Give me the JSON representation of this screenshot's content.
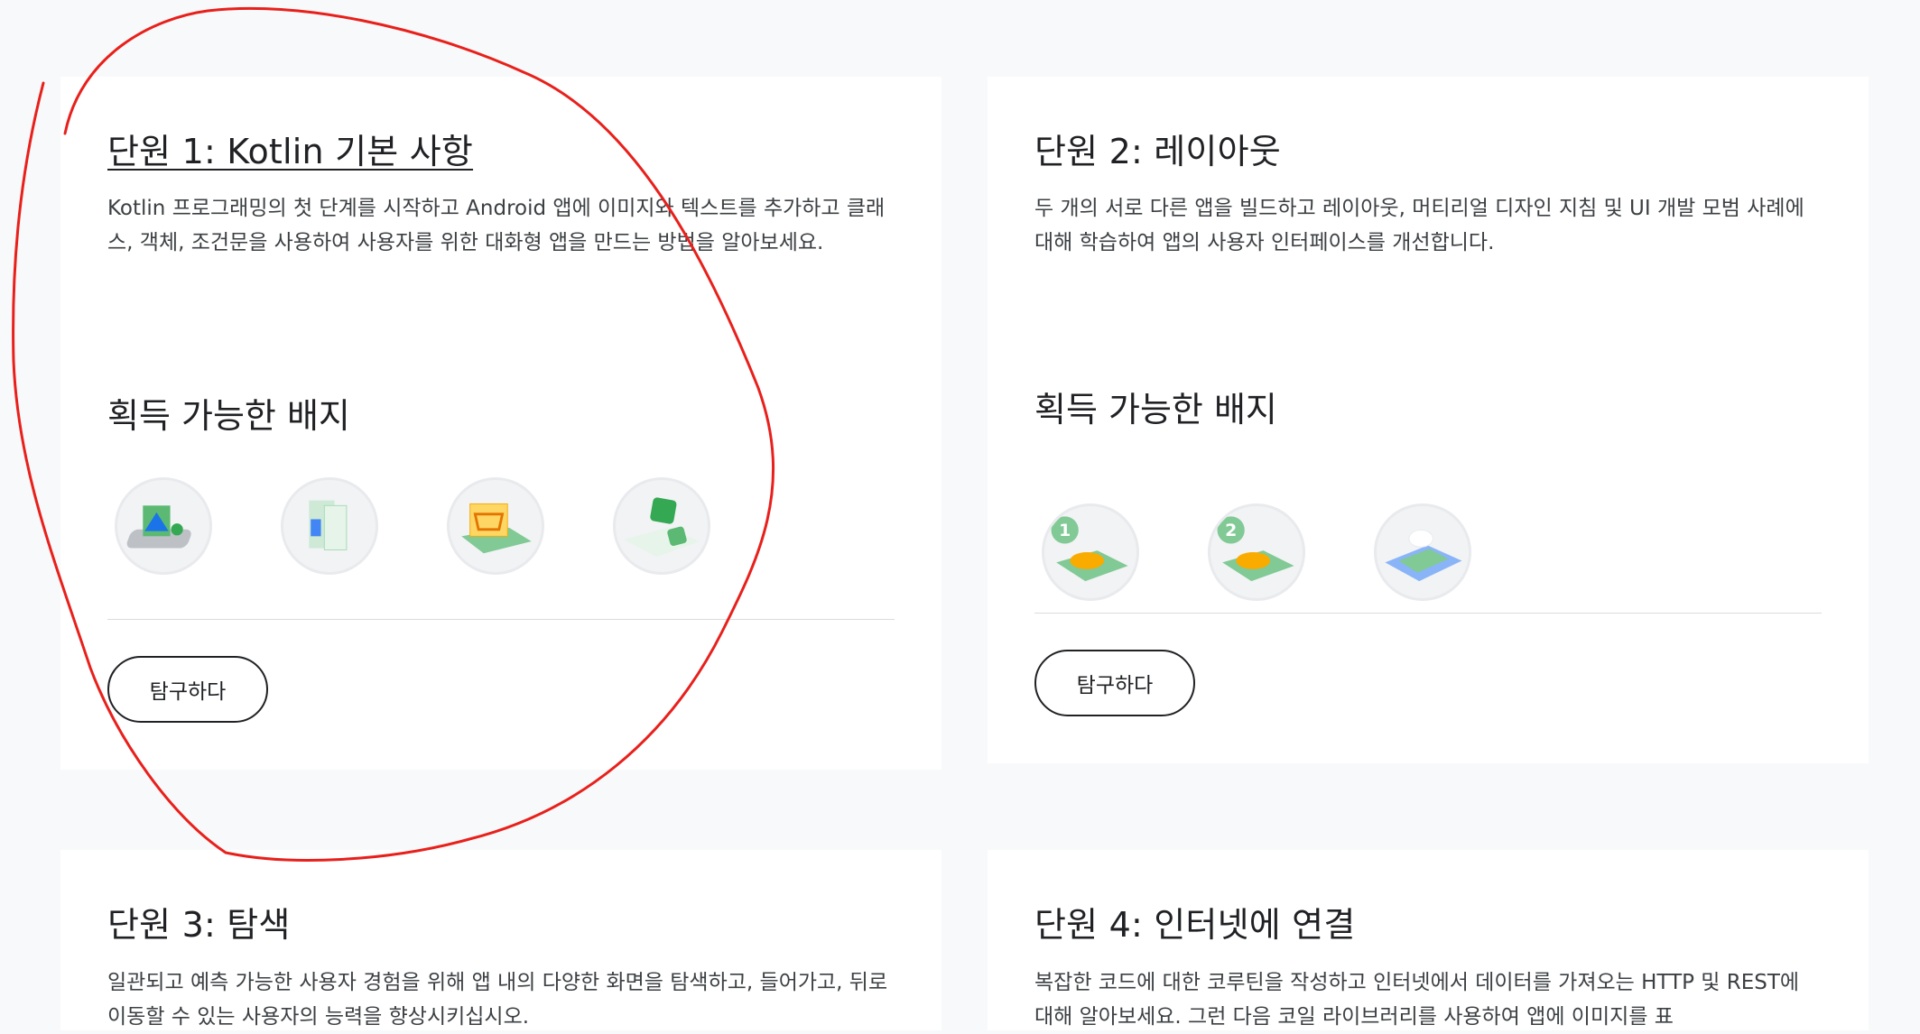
{
  "colors": {
    "page_bg": "#f8f9fa",
    "card_bg": "#ffffff",
    "annotation": "#e8201c",
    "badge_green": "#81c995"
  },
  "units": [
    {
      "title": "단원 1: Kotlin 기본 사항",
      "description": "Kotlin 프로그래밍의 첫 단계를 시작하고 Android 앱에 이미지와 텍스트를 추가하고 클래스, 객체, 조건문을 사용하여 사용자를 위한 대화형 앱을 만드는 방법을 알아보세요.",
      "badges_heading": "획득 가능한 배지",
      "badges": [
        "android-app-badge-icon",
        "layout-image-badge-icon",
        "shopping-cart-badge-icon",
        "dice-roller-badge-icon"
      ],
      "explore_label": "탐구하다"
    },
    {
      "title": "단원 2: 레이아웃",
      "description": "두 개의 서로 다른 앱을 빌드하고 레이아웃, 머티리얼 디자인 지침 및 UI 개발 모범 사례에 대해 학습하여 앱의 사용자 인터페이스를 개선합니다.",
      "badges_heading": "획득 가능한 배지",
      "badges": [
        "tip-calculator-1-badge-icon",
        "tip-calculator-2-badge-icon",
        "material-design-badge-icon"
      ],
      "badge_numbers": [
        "1",
        "2"
      ],
      "explore_label": "탐구하다"
    },
    {
      "title": "단원 3: 탐색",
      "description": "일관되고 예측 가능한 사용자 경험을 위해 앱 내의 다양한 화면을 탐색하고, 들어가고, 뒤로 이동할 수 있는 사용자의 능력을 향상시키십시오."
    },
    {
      "title": "단원 4: 인터넷에 연결",
      "description": "복잡한 코드에 대한 코루틴을 작성하고 인터넷에서 데이터를 가져오는 HTTP 및 REST에 대해 알아보세요. 그런 다음 코일 라이브러리를 사용하여 앱에 이미지를 표"
    }
  ]
}
